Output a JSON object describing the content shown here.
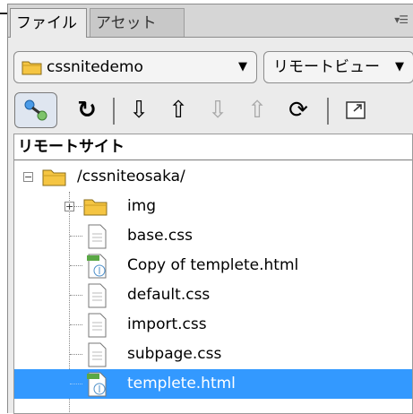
{
  "tabs": [
    {
      "label": "ファイル",
      "active": true
    },
    {
      "label": "アセット",
      "active": false
    }
  ],
  "tab_menu_icon": "panel-menu-icon",
  "site_select": {
    "value": "cssnitedemo",
    "icon": "folder-icon"
  },
  "view_select": {
    "value": "リモートビュー"
  },
  "toolbar": {
    "buttons": [
      "connect-icon",
      "refresh-icon",
      "get-icon",
      "put-icon",
      "checkout-icon",
      "checkin-icon",
      "sync-icon",
      "expand-icon"
    ]
  },
  "panel_header": "リモートサイト",
  "tree": {
    "root": "/cssniteosaka/",
    "items": [
      {
        "name": "img",
        "type": "folder"
      },
      {
        "name": "base.css",
        "type": "file"
      },
      {
        "name": "Copy of templete.html",
        "type": "html"
      },
      {
        "name": "default.css",
        "type": "file"
      },
      {
        "name": "import.css",
        "type": "file"
      },
      {
        "name": "subpage.css",
        "type": "file"
      },
      {
        "name": "templete.html",
        "type": "html",
        "selected": true
      }
    ]
  },
  "colors": {
    "selection": "#3399ff",
    "folder": "#f5c542"
  }
}
